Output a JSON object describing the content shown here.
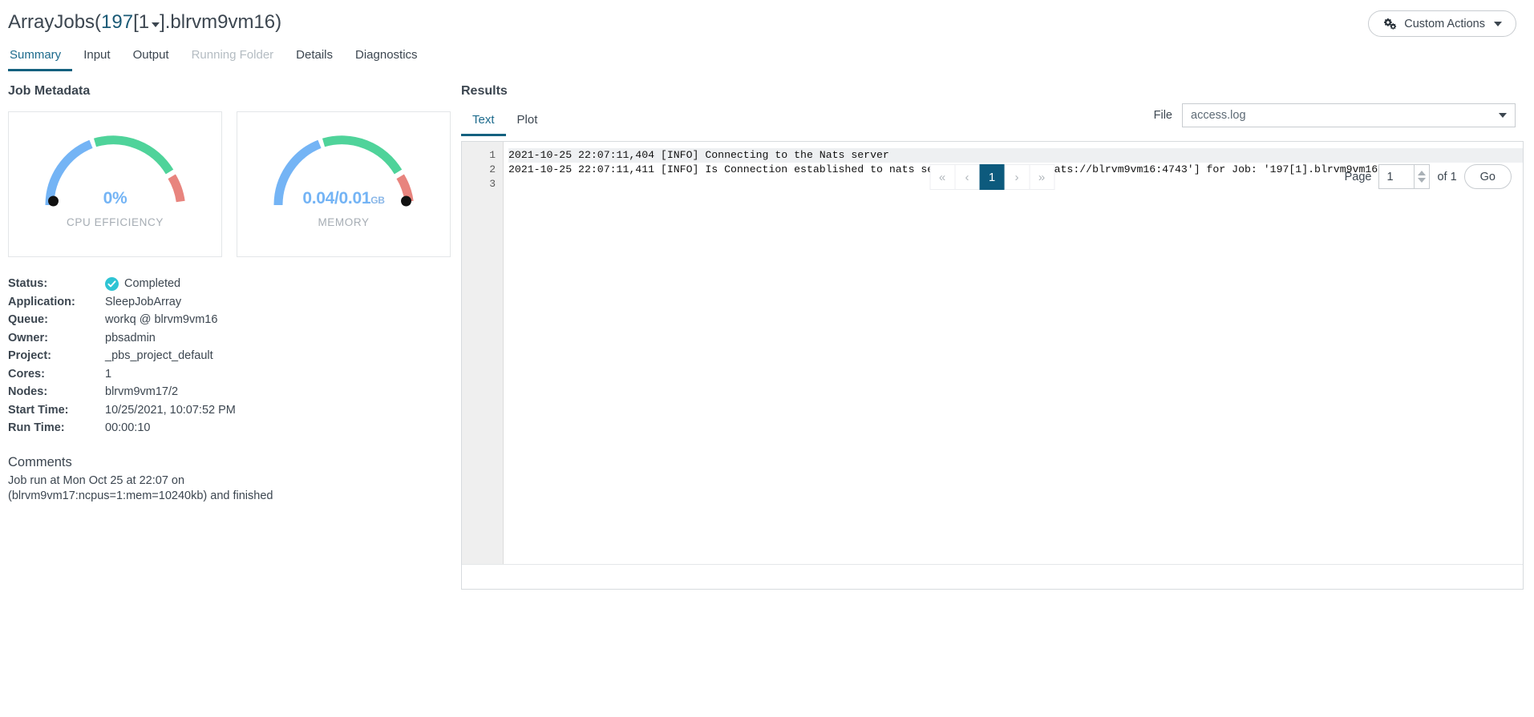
{
  "header": {
    "title_prefix": "ArrayJobs(",
    "title_index": "197",
    "title_subindex": "[1",
    "title_suffix": "].blrvm9vm16)",
    "custom_actions_label": "Custom Actions"
  },
  "main_tabs": [
    {
      "label": "Summary",
      "state": "active"
    },
    {
      "label": "Input",
      "state": "normal"
    },
    {
      "label": "Output",
      "state": "normal"
    },
    {
      "label": "Running Folder",
      "state": "disabled"
    },
    {
      "label": "Details",
      "state": "normal"
    },
    {
      "label": "Diagnostics",
      "state": "normal"
    }
  ],
  "job_metadata": {
    "title": "Job Metadata",
    "gauges": [
      {
        "value": "0%",
        "unit": "",
        "label": "CPU EFFICIENCY",
        "percent": 0
      },
      {
        "value": "0.04/0.01",
        "unit": "GB",
        "label": "MEMORY",
        "percent": 100
      }
    ],
    "fields": [
      {
        "key": "Status:",
        "value": "Completed",
        "icon": "check-circle-icon"
      },
      {
        "key": "Application:",
        "value": "SleepJobArray"
      },
      {
        "key": "Queue:",
        "value": "workq @ blrvm9vm16"
      },
      {
        "key": "Owner:",
        "value": "pbsadmin"
      },
      {
        "key": "Project:",
        "value": "_pbs_project_default"
      },
      {
        "key": "Cores:",
        "value": "1"
      },
      {
        "key": "Nodes:",
        "value": "blrvm9vm17/2"
      },
      {
        "key": "Start Time:",
        "value": "10/25/2021, 10:07:52 PM"
      },
      {
        "key": "Run Time:",
        "value": "00:00:10"
      }
    ],
    "comments_title": "Comments",
    "comments_body": "Job run at Mon Oct 25 at 22:07 on (blrvm9vm17:ncpus=1:mem=10240kb) and finished"
  },
  "results": {
    "title": "Results",
    "tabs": [
      {
        "label": "Text",
        "state": "active"
      },
      {
        "label": "Plot",
        "state": "normal"
      }
    ],
    "file_label": "File",
    "file_value": "access.log",
    "line_numbers": [
      "1",
      "2",
      "3"
    ],
    "lines": [
      "2021-10-25 22:07:11,404 [INFO] Connecting to the Nats server",
      "2021-10-25 22:07:11,411 [INFO] Is Connection established to nats server using URL: ['nats://blrvm9vm16:4743'] for Job: '197[1].blrvm9vm16': True",
      ""
    ],
    "pagination": {
      "first": "«",
      "prev": "‹",
      "current": "1",
      "next": "›",
      "last": "»",
      "page_label": "Page",
      "page_value": "1",
      "of_label": "of 1",
      "go_label": "Go"
    }
  },
  "colors": {
    "accent": "#14617f",
    "gauge_blue": "#74b4f5",
    "gauge_green": "#4fd39a",
    "gauge_red": "#e8847e",
    "status_check": "#2ec4d4",
    "pager_active": "#0d5a7d"
  }
}
